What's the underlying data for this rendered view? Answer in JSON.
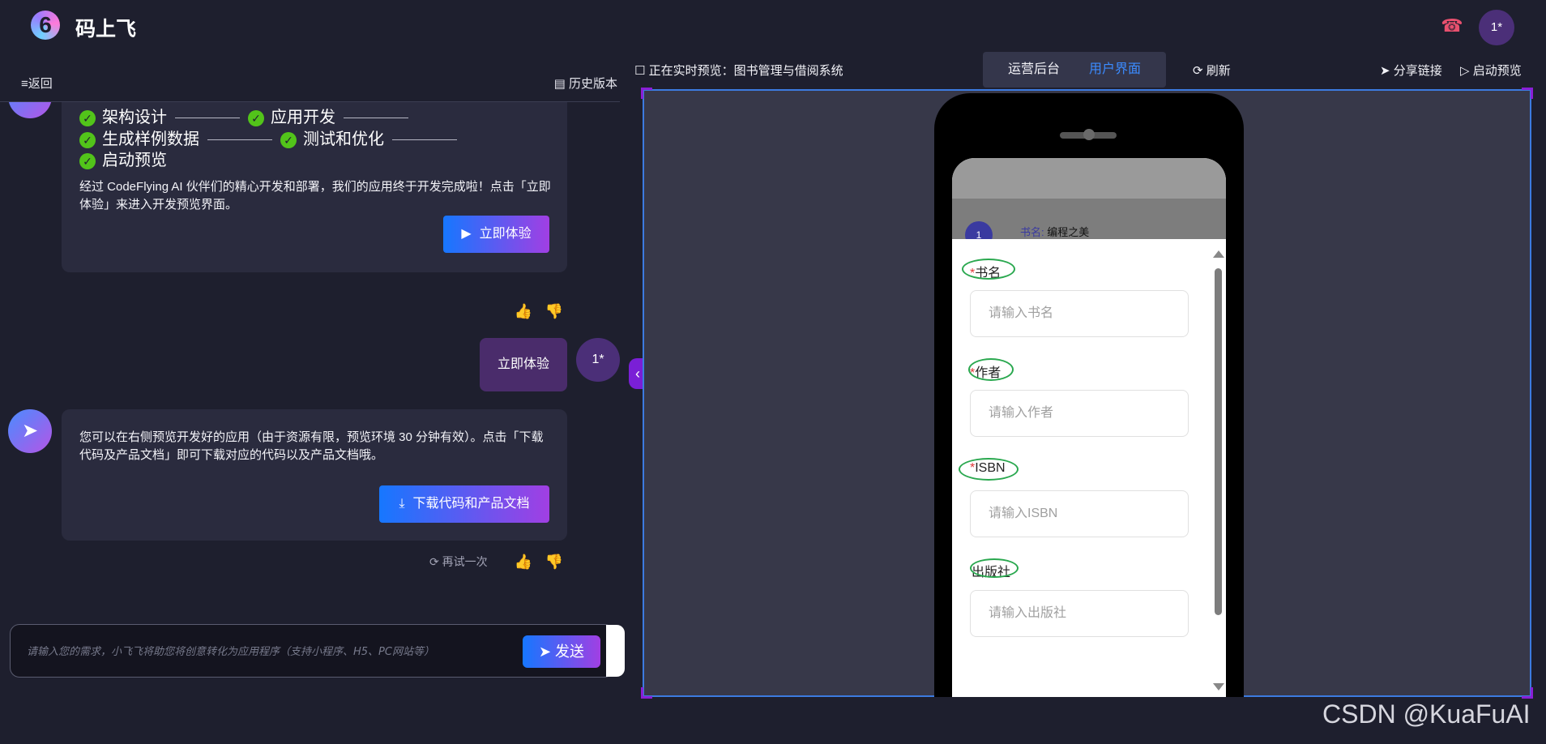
{
  "header": {
    "app_title": "码上飞",
    "user_avatar": "1*",
    "support_icon": "headset-icon"
  },
  "left_toolbar": {
    "back_label": "≡返回",
    "history_label": "历史版本"
  },
  "chat": {
    "steps_row1": [
      "架构设计",
      "应用开发"
    ],
    "steps_row2": [
      "生成样例数据",
      "测试和优化"
    ],
    "steps_row3": [
      "启动预览"
    ],
    "message1": "经过 CodeFlying AI 伙伴们的精心开发和部署，我们的应用终于开发完成啦！点击「立即体验」来进入开发预览界面。",
    "try_now_button": "立即体验",
    "user_message": "立即体验",
    "user_avatar": "1*",
    "message2": "您可以在右侧预览开发好的应用（由于资源有限，预览环境 30 分钟有效）。点击「下载代码及产品文档」即可下载对应的代码以及产品文档哦。",
    "download_button": "下载代码和产品文档",
    "retry_label": "再试一次"
  },
  "composer": {
    "placeholder": "请输入您的需求，小飞飞将助您将创意转化为应用程序（支持小程序、H5、PC网站等）",
    "send_label": "发送"
  },
  "preview_toolbar": {
    "status_label": "正在实时预览：图书管理与借阅系统",
    "tabs": [
      {
        "label": "运营后台",
        "active": false
      },
      {
        "label": "用户界面",
        "active": true
      }
    ],
    "refresh_label": "刷新",
    "share_label": "分享链接",
    "launch_label": "启动预览"
  },
  "phone": {
    "list_item": {
      "index": "1",
      "key": "书名:",
      "value": "编程之美"
    },
    "form": [
      {
        "label": "书名",
        "required": true,
        "placeholder": "请输入书名"
      },
      {
        "label": "作者",
        "required": true,
        "placeholder": "请输入作者"
      },
      {
        "label": "ISBN",
        "required": true,
        "placeholder": "请输入ISBN"
      },
      {
        "label": "出版社",
        "required": false,
        "placeholder": "请输入出版社"
      }
    ]
  },
  "watermark": "CSDN @KuaFuAI",
  "colors": {
    "background": "#1e1f2e",
    "accent_blue": "#1677ff",
    "accent_purple": "#a13fe3",
    "active_tab": "#3b8bff",
    "check_green": "#52c41a"
  }
}
